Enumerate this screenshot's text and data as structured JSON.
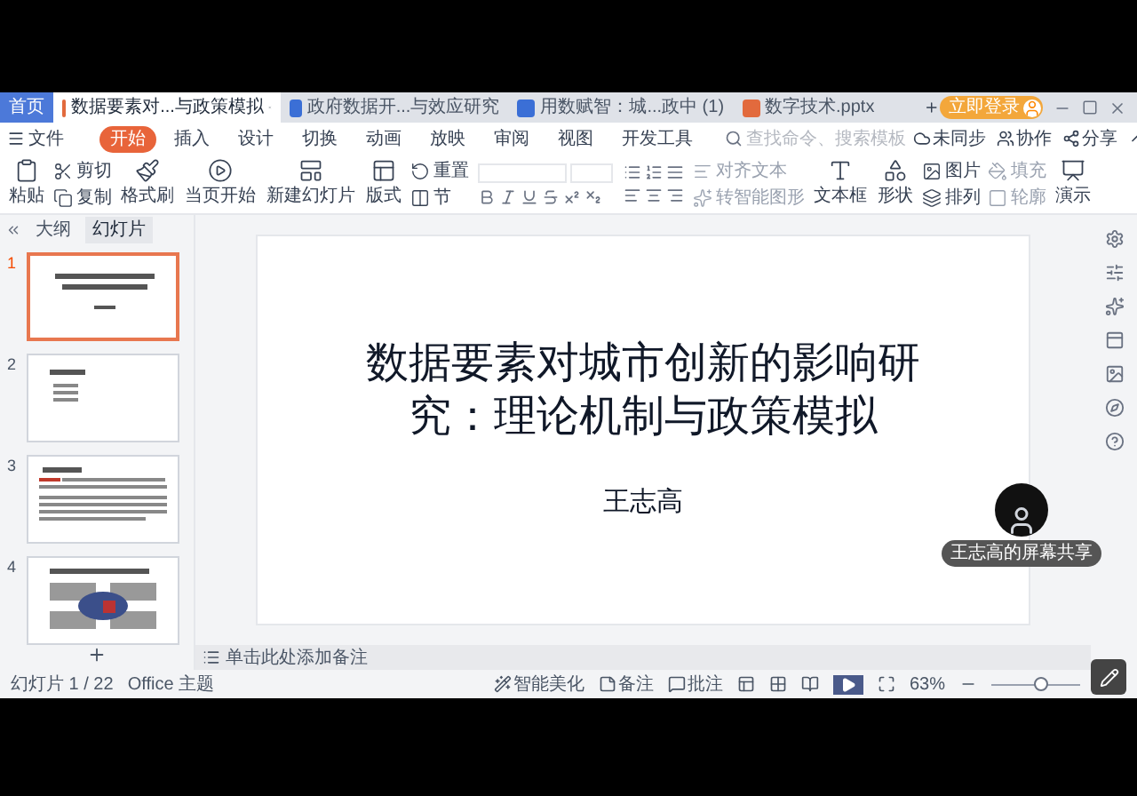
{
  "tabs": [
    {
      "label": "首页",
      "kind": "home",
      "selected": false
    },
    {
      "label": "数据要素对...与政策模拟",
      "kind": "ppt",
      "selected": true
    },
    {
      "label": "政府数据开...与效应研究",
      "kind": "doc",
      "selected": false
    },
    {
      "label": "用数赋智：城...政中 (1)",
      "kind": "doc",
      "selected": false
    },
    {
      "label": "数字技术.pptx",
      "kind": "ppt",
      "selected": false
    }
  ],
  "login": "立即登录",
  "file_menu": "文件",
  "ribbon_tabs": [
    {
      "label": "开始",
      "selected": true
    },
    {
      "label": "插入",
      "selected": false
    },
    {
      "label": "设计",
      "selected": false
    },
    {
      "label": "切换",
      "selected": false
    },
    {
      "label": "动画",
      "selected": false
    },
    {
      "label": "放映",
      "selected": false
    },
    {
      "label": "审阅",
      "selected": false
    },
    {
      "label": "视图",
      "selected": false
    },
    {
      "label": "开发工具",
      "selected": false
    }
  ],
  "search": {
    "placeholder": "查找命令、搜索模板"
  },
  "sync": "未同步",
  "collab": "协作",
  "share": "分享",
  "ribbon_left": [
    {
      "kind": "large",
      "label": "粘贴",
      "disabled": false
    },
    {
      "kind": "stack",
      "items": [
        {
          "label": "剪切",
          "disabled": false
        },
        {
          "label": "复制",
          "disabled": false
        }
      ]
    },
    {
      "kind": "large",
      "label": "格式刷",
      "disabled": false
    },
    {
      "kind": "large",
      "label": "当页开始",
      "disabled": false
    },
    {
      "kind": "large",
      "label": "新建幻灯片",
      "disabled": false
    },
    {
      "kind": "large",
      "label": "版式",
      "disabled": false
    },
    {
      "kind": "stack",
      "items": [
        {
          "label": "重置",
          "disabled": false
        },
        {
          "label": "节",
          "disabled": false
        }
      ]
    }
  ],
  "ribbon_right": [
    {
      "kind": "stack",
      "items": [
        {
          "label": "对齐文本",
          "disabled": true
        },
        {
          "label": "转智能图形",
          "disabled": true
        }
      ]
    },
    {
      "kind": "large",
      "label": "文本框",
      "disabled": false
    },
    {
      "kind": "large",
      "label": "形状",
      "disabled": false
    },
    {
      "kind": "stack",
      "items": [
        {
          "label": "图片",
          "disabled": false
        },
        {
          "label": "排列",
          "disabled": false
        }
      ]
    },
    {
      "kind": "stack",
      "items": [
        {
          "label": "填充",
          "disabled": true
        },
        {
          "label": "轮廓",
          "disabled": true
        }
      ]
    },
    {
      "kind": "large",
      "label": "演示",
      "disabled": false
    }
  ],
  "panel_tabs": [
    {
      "label": "大纲",
      "selected": false
    },
    {
      "label": "幻灯片",
      "selected": true
    }
  ],
  "thumbnails": [
    {
      "number": "1",
      "kind": "title",
      "selected": true
    },
    {
      "number": "2",
      "kind": "list",
      "selected": false
    },
    {
      "number": "3",
      "kind": "text",
      "selected": false
    },
    {
      "number": "4",
      "kind": "diagram",
      "selected": false
    }
  ],
  "slide": {
    "title": "数据要素对城市创新的影响研究：理论机制与政策模拟",
    "author": "王志高"
  },
  "notes": {
    "placeholder": "单击此处添加备注"
  },
  "status": {
    "slide_count": "幻灯片 1 / 22",
    "theme": "Office 主题",
    "beautify": "智能美化",
    "notes": "备注",
    "comments": "批注",
    "zoom": "63%",
    "zoom_slider": {
      "level": 0.55
    }
  },
  "screen_share": "王志高的屏幕共享"
}
